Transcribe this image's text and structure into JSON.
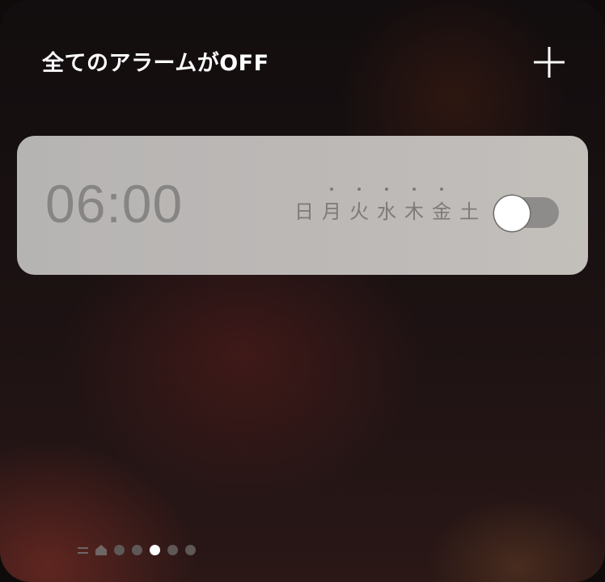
{
  "header": {
    "title": "全てのアラームがOFF",
    "add_icon": "plus-icon"
  },
  "alarm": {
    "time": "06:00",
    "enabled": false,
    "weekdays": [
      {
        "label": "日",
        "dot": false
      },
      {
        "label": "月",
        "dot": true
      },
      {
        "label": "火",
        "dot": true
      },
      {
        "label": "水",
        "dot": true
      },
      {
        "label": "木",
        "dot": true
      },
      {
        "label": "金",
        "dot": true
      },
      {
        "label": "土",
        "dot": false
      }
    ]
  },
  "page_indicator": {
    "items": [
      "menu-icon",
      "home-icon",
      "dot",
      "dot",
      "dot",
      "dot",
      "dot"
    ],
    "active_index": 4
  },
  "colors": {
    "card_background": "#bcb8b6",
    "time_text": "#878584",
    "toggle_track": "#8e8c8b",
    "active_dot": "#ffffff"
  }
}
